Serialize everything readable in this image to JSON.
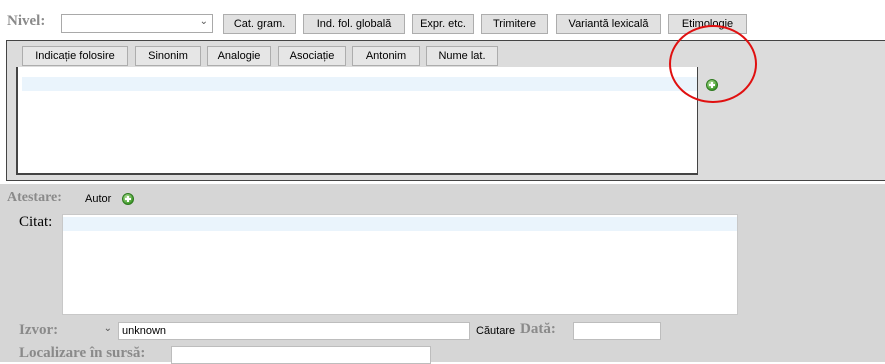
{
  "nivel": {
    "label": "Nivel:",
    "value": ""
  },
  "top_tabs": [
    "Cat. gram.",
    "Ind. fol. globală",
    "Expr. etc.",
    "Trimitere",
    "Variantă lexicală",
    "Etimologie"
  ],
  "sub_tabs": [
    "Indicație folosire",
    "Sinonim",
    "Analogie",
    "Asociație",
    "Antonim",
    "Nume lat."
  ],
  "atestare": {
    "label": "Atestare:",
    "autor_label": "Autor"
  },
  "citat": {
    "label": "Citat:",
    "value": ""
  },
  "izvor": {
    "label": "Izvor:",
    "select_value": "",
    "value": "unknown",
    "cautare_label": "Căutare"
  },
  "data_field": {
    "label": "Dată:",
    "value": ""
  },
  "localizare": {
    "label": "Localizare în sursă:",
    "value": ""
  },
  "colors": {
    "panel_bg": "#dcdcdc",
    "highlight_row": "#eaf4fc",
    "annotation_circle": "#e01010"
  }
}
